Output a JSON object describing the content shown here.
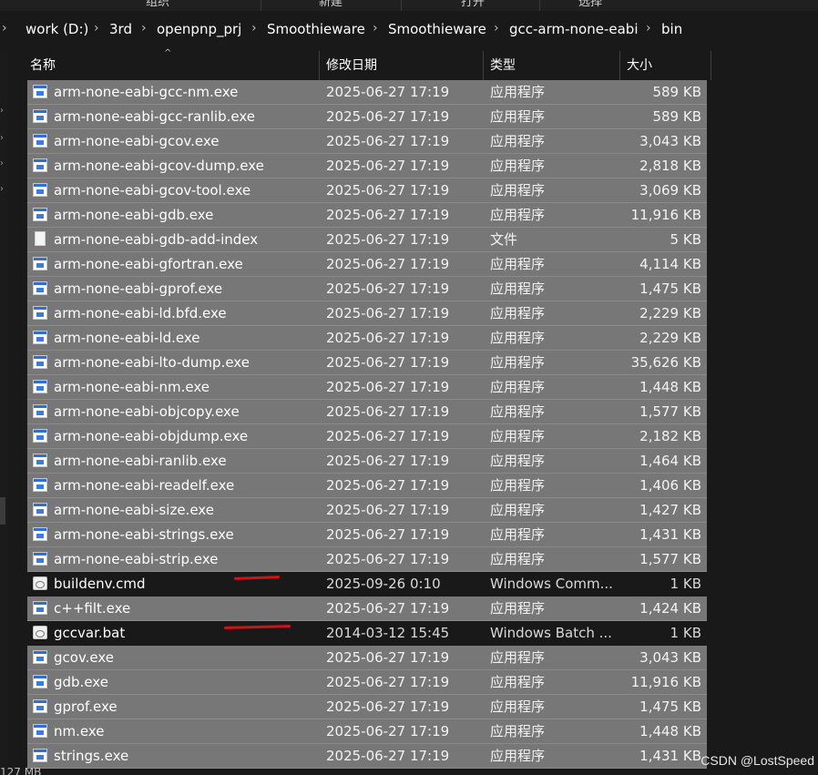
{
  "ribbon": {
    "buttons": [
      "组织",
      "新建",
      "打开",
      "选择"
    ]
  },
  "breadcrumb": [
    "work (D:)",
    "3rd",
    "openpnp_prj",
    "Smoothieware",
    "Smoothieware",
    "gcc-arm-none-eabi",
    "bin"
  ],
  "columns": {
    "name": "名称",
    "date": "修改日期",
    "type": "类型",
    "size": "大小"
  },
  "files": [
    {
      "name": "arm-none-eabi-gcc-nm.exe",
      "date": "2025-06-27 17:19",
      "type": "应用程序",
      "size": "589 KB",
      "icon": "exe-icon",
      "selected": true
    },
    {
      "name": "arm-none-eabi-gcc-ranlib.exe",
      "date": "2025-06-27 17:19",
      "type": "应用程序",
      "size": "589 KB",
      "icon": "exe-icon",
      "selected": true
    },
    {
      "name": "arm-none-eabi-gcov.exe",
      "date": "2025-06-27 17:19",
      "type": "应用程序",
      "size": "3,043 KB",
      "icon": "exe-icon",
      "selected": true
    },
    {
      "name": "arm-none-eabi-gcov-dump.exe",
      "date": "2025-06-27 17:19",
      "type": "应用程序",
      "size": "2,818 KB",
      "icon": "exe-icon",
      "selected": true
    },
    {
      "name": "arm-none-eabi-gcov-tool.exe",
      "date": "2025-06-27 17:19",
      "type": "应用程序",
      "size": "3,069 KB",
      "icon": "exe-icon",
      "selected": true
    },
    {
      "name": "arm-none-eabi-gdb.exe",
      "date": "2025-06-27 17:19",
      "type": "应用程序",
      "size": "11,916 KB",
      "icon": "exe-icon",
      "selected": true
    },
    {
      "name": "arm-none-eabi-gdb-add-index",
      "date": "2025-06-27 17:19",
      "type": "文件",
      "size": "5 KB",
      "icon": "file-icon",
      "selected": true
    },
    {
      "name": "arm-none-eabi-gfortran.exe",
      "date": "2025-06-27 17:19",
      "type": "应用程序",
      "size": "4,114 KB",
      "icon": "exe-icon",
      "selected": true
    },
    {
      "name": "arm-none-eabi-gprof.exe",
      "date": "2025-06-27 17:19",
      "type": "应用程序",
      "size": "1,475 KB",
      "icon": "exe-icon",
      "selected": true
    },
    {
      "name": "arm-none-eabi-ld.bfd.exe",
      "date": "2025-06-27 17:19",
      "type": "应用程序",
      "size": "2,229 KB",
      "icon": "exe-icon",
      "selected": true
    },
    {
      "name": "arm-none-eabi-ld.exe",
      "date": "2025-06-27 17:19",
      "type": "应用程序",
      "size": "2,229 KB",
      "icon": "exe-icon",
      "selected": true
    },
    {
      "name": "arm-none-eabi-lto-dump.exe",
      "date": "2025-06-27 17:19",
      "type": "应用程序",
      "size": "35,626 KB",
      "icon": "exe-icon",
      "selected": true
    },
    {
      "name": "arm-none-eabi-nm.exe",
      "date": "2025-06-27 17:19",
      "type": "应用程序",
      "size": "1,448 KB",
      "icon": "exe-icon",
      "selected": true
    },
    {
      "name": "arm-none-eabi-objcopy.exe",
      "date": "2025-06-27 17:19",
      "type": "应用程序",
      "size": "1,577 KB",
      "icon": "exe-icon",
      "selected": true
    },
    {
      "name": "arm-none-eabi-objdump.exe",
      "date": "2025-06-27 17:19",
      "type": "应用程序",
      "size": "2,182 KB",
      "icon": "exe-icon",
      "selected": true
    },
    {
      "name": "arm-none-eabi-ranlib.exe",
      "date": "2025-06-27 17:19",
      "type": "应用程序",
      "size": "1,464 KB",
      "icon": "exe-icon",
      "selected": true
    },
    {
      "name": "arm-none-eabi-readelf.exe",
      "date": "2025-06-27 17:19",
      "type": "应用程序",
      "size": "1,406 KB",
      "icon": "exe-icon",
      "selected": true
    },
    {
      "name": "arm-none-eabi-size.exe",
      "date": "2025-06-27 17:19",
      "type": "应用程序",
      "size": "1,427 KB",
      "icon": "exe-icon",
      "selected": true
    },
    {
      "name": "arm-none-eabi-strings.exe",
      "date": "2025-06-27 17:19",
      "type": "应用程序",
      "size": "1,431 KB",
      "icon": "exe-icon",
      "selected": true
    },
    {
      "name": "arm-none-eabi-strip.exe",
      "date": "2025-06-27 17:19",
      "type": "应用程序",
      "size": "1,577 KB",
      "icon": "exe-icon",
      "selected": true
    },
    {
      "name": "buildenv.cmd",
      "date": "2025-09-26 0:10",
      "type": "Windows Comm...",
      "size": "1 KB",
      "icon": "cmd-icon",
      "selected": false
    },
    {
      "name": "c++filt.exe",
      "date": "2025-06-27 17:19",
      "type": "应用程序",
      "size": "1,424 KB",
      "icon": "exe-icon",
      "selected": true
    },
    {
      "name": "gccvar.bat",
      "date": "2014-03-12 15:45",
      "type": "Windows Batch ...",
      "size": "1 KB",
      "icon": "cmd-icon",
      "selected": false
    },
    {
      "name": "gcov.exe",
      "date": "2025-06-27 17:19",
      "type": "应用程序",
      "size": "3,043 KB",
      "icon": "exe-icon",
      "selected": true
    },
    {
      "name": "gdb.exe",
      "date": "2025-06-27 17:19",
      "type": "应用程序",
      "size": "11,916 KB",
      "icon": "exe-icon",
      "selected": true
    },
    {
      "name": "gprof.exe",
      "date": "2025-06-27 17:19",
      "type": "应用程序",
      "size": "1,475 KB",
      "icon": "exe-icon",
      "selected": true
    },
    {
      "name": "nm.exe",
      "date": "2025-06-27 17:19",
      "type": "应用程序",
      "size": "1,448 KB",
      "icon": "exe-icon",
      "selected": true
    },
    {
      "name": "strings.exe",
      "date": "2025-06-27 17:19",
      "type": "应用程序",
      "size": "1,431 KB",
      "icon": "exe-icon",
      "selected": true
    }
  ],
  "status": "127 MB",
  "watermark": "CSDN @LostSpeed",
  "colors": {
    "selected_row": "#777777",
    "background": "#191919",
    "annotation": "#d0131a"
  }
}
